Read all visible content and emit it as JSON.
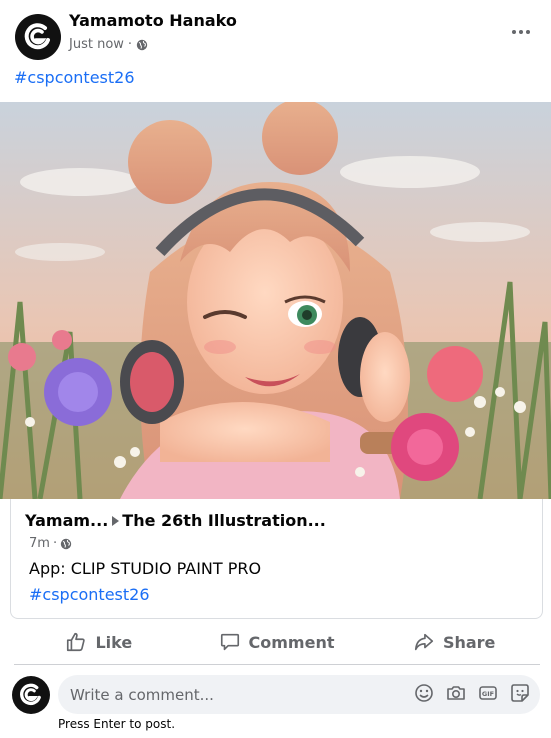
{
  "post": {
    "author": "Yamamoto Hanako",
    "timestamp": "Just now",
    "privacy_icon": "globe-icon",
    "hashtag": "#cspcontest26",
    "image_alt": "Anime-style illustration of a girl with headphones winking among flowers"
  },
  "shared": {
    "author_short": "Yamam...",
    "group_name": "The 26th Illustration...",
    "time": "7m",
    "text": "App: CLIP STUDIO PAINT PRO",
    "hashtag": "#cspcontest26"
  },
  "actions": {
    "like": "Like",
    "comment": "Comment",
    "share": "Share"
  },
  "composer": {
    "placeholder": "Write a comment...",
    "hint": "Press Enter to post.",
    "icons": [
      "emoji-icon",
      "camera-icon",
      "gif-icon",
      "sticker-icon"
    ]
  },
  "colors": {
    "link": "#1a6ef5",
    "secondary_text": "#65676b",
    "input_bg": "#f0f2f5"
  }
}
